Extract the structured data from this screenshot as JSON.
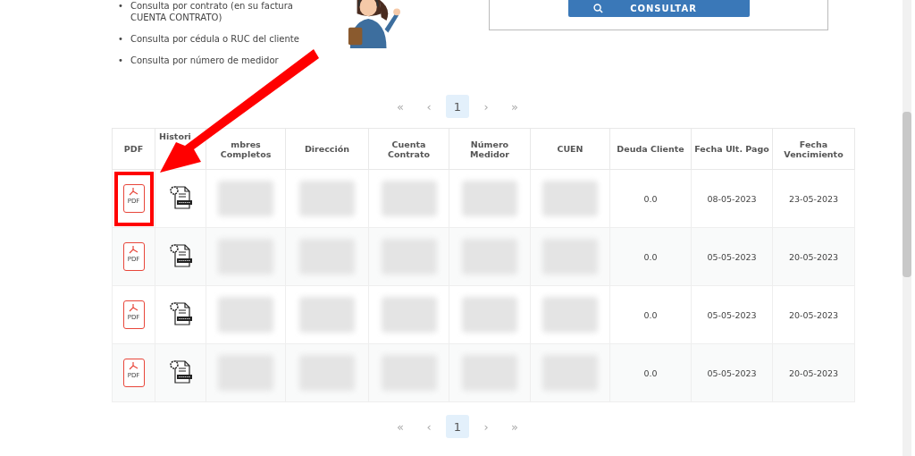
{
  "consulta_options": [
    {
      "bullet": "•",
      "text": "Consulta por contrato (en su factura CUENTA CONTRATO)"
    },
    {
      "bullet": "•",
      "text": "Consulta por cédula o RUC del cliente"
    },
    {
      "bullet": "•",
      "text": "Consulta por número de medidor"
    }
  ],
  "search_button": {
    "label": "CONSULTAR"
  },
  "pagination_top": {
    "first": "«",
    "prev": "‹",
    "pages": [
      {
        "label": "1",
        "selected": true
      }
    ],
    "next": "›",
    "last": "»"
  },
  "table": {
    "columns": [
      {
        "label": "PDF",
        "kind": "pdf"
      },
      {
        "label": "Histori",
        "kind": "history"
      },
      {
        "label": "mbres Completos",
        "kind": "redacted"
      },
      {
        "label": "Dirección",
        "kind": "redacted"
      },
      {
        "label": "Cuenta Contrato",
        "kind": "redacted"
      },
      {
        "label": "Número Medidor",
        "kind": "redacted"
      },
      {
        "label": "CUEN",
        "kind": "redacted"
      },
      {
        "label": "Deuda Cliente",
        "kind": "value"
      },
      {
        "label": "Fecha Ult. Pago",
        "kind": "value"
      },
      {
        "label": "Fecha Vencimiento",
        "kind": "value"
      }
    ],
    "rows": [
      {
        "pdf_label": "PDF",
        "values": [
          "0.0",
          "08-05-2023",
          "23-05-2023"
        ],
        "highlighted": true
      },
      {
        "pdf_label": "PDF",
        "values": [
          "0.0",
          "05-05-2023",
          "20-05-2023"
        ],
        "highlighted": false
      },
      {
        "pdf_label": "PDF",
        "values": [
          "0.0",
          "05-05-2023",
          "20-05-2023"
        ],
        "highlighted": false
      },
      {
        "pdf_label": "PDF",
        "values": [
          "0.0",
          "05-05-2023",
          "20-05-2023"
        ],
        "highlighted": false
      }
    ]
  },
  "pagination_bottom": {
    "first": "«",
    "prev": "‹",
    "pages": [
      {
        "label": "1",
        "selected": true
      }
    ],
    "next": "›",
    "last": "»"
  }
}
